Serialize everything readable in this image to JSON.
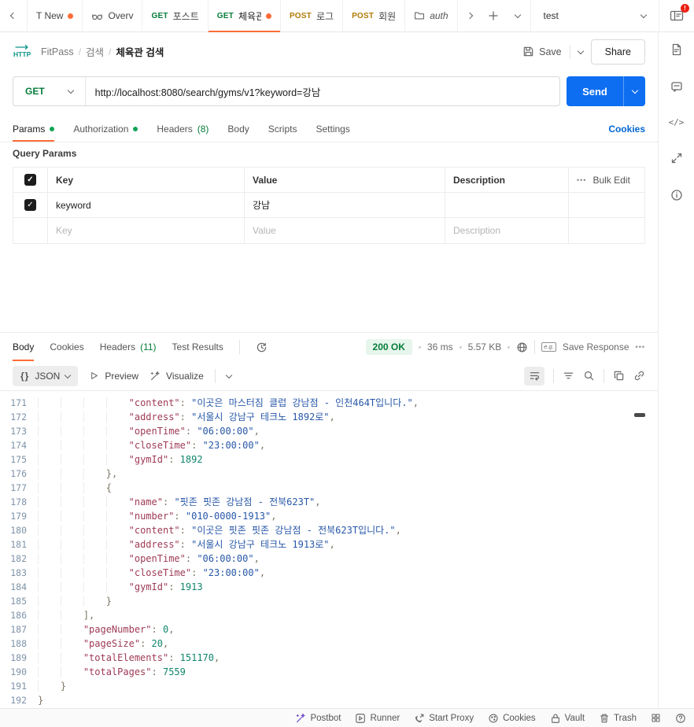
{
  "tab_bar": {
    "tabs": [
      {
        "method": "",
        "label": "T New",
        "modified": true
      },
      {
        "method": "",
        "label": "Overv",
        "icon": "overview-goggles-icon"
      },
      {
        "method": "GET",
        "label": "포스트"
      },
      {
        "method": "GET",
        "label": "체육관",
        "modified": true,
        "active": true
      },
      {
        "method": "POST",
        "label": "로그"
      },
      {
        "method": "POST",
        "label": "회원"
      },
      {
        "method": "",
        "label": "auth",
        "icon": "folder-icon"
      }
    ],
    "workspace": "test",
    "notification_badge": "!"
  },
  "header": {
    "breadcrumb": {
      "collection": "FitPass",
      "folder": "검색",
      "request": "체육관 검색",
      "separator": "/"
    },
    "save_label": "Save",
    "share_label": "Share"
  },
  "request": {
    "method": "GET",
    "url": "http://localhost:8080/search/gyms/v1?keyword=강남",
    "send_label": "Send",
    "tabs": [
      {
        "label": "Params",
        "dot": true,
        "active": true
      },
      {
        "label": "Authorization",
        "dot": true
      },
      {
        "label": "Headers",
        "count": "(8)"
      },
      {
        "label": "Body"
      },
      {
        "label": "Scripts"
      },
      {
        "label": "Settings"
      }
    ],
    "cookies_link": "Cookies",
    "query_params_label": "Query Params",
    "params_table": {
      "headers": {
        "key": "Key",
        "value": "Value",
        "description": "Description",
        "bulk_edit": "Bulk Edit"
      },
      "rows": [
        {
          "checked": true,
          "key": "keyword",
          "value": "강남",
          "description": ""
        }
      ],
      "placeholder": {
        "key": "Key",
        "value": "Value",
        "description": "Description"
      }
    }
  },
  "response": {
    "tabs": [
      {
        "label": "Body",
        "active": true
      },
      {
        "label": "Cookies"
      },
      {
        "label": "Headers",
        "count": "(11)"
      },
      {
        "label": "Test Results"
      }
    ],
    "status": {
      "code_text": "200 OK",
      "time": "36 ms",
      "size": "5.57 KB"
    },
    "save_response_label": "Save Response",
    "toolbar": {
      "braces_glyph": "{}",
      "format": "JSON",
      "preview_label": "Preview",
      "visualize_label": "Visualize"
    },
    "code": {
      "lines": [
        {
          "n": 171,
          "text": "                \"content\": \"이곳은 마스터짐 클럽 강남점 - 인천464T입니다.\","
        },
        {
          "n": 172,
          "text": "                \"address\": \"서울시 강남구 테크노 1892로\","
        },
        {
          "n": 173,
          "text": "                \"openTime\": \"06:00:00\","
        },
        {
          "n": 174,
          "text": "                \"closeTime\": \"23:00:00\","
        },
        {
          "n": 175,
          "text": "                \"gymId\": 1892"
        },
        {
          "n": 176,
          "text": "            },"
        },
        {
          "n": 177,
          "text": "            {"
        },
        {
          "n": 178,
          "text": "                \"name\": \"핏존 핏존 강남점 - 전북623T\","
        },
        {
          "n": 179,
          "text": "                \"number\": \"010-0000-1913\","
        },
        {
          "n": 180,
          "text": "                \"content\": \"이곳은 핏존 핏존 강남점 - 전북623T입니다.\","
        },
        {
          "n": 181,
          "text": "                \"address\": \"서울시 강남구 테크노 1913로\","
        },
        {
          "n": 182,
          "text": "                \"openTime\": \"06:00:00\","
        },
        {
          "n": 183,
          "text": "                \"closeTime\": \"23:00:00\","
        },
        {
          "n": 184,
          "text": "                \"gymId\": 1913"
        },
        {
          "n": 185,
          "text": "            }"
        },
        {
          "n": 186,
          "text": "        ],"
        },
        {
          "n": 187,
          "text": "        \"pageNumber\": 0,"
        },
        {
          "n": 188,
          "text": "        \"pageSize\": 20,"
        },
        {
          "n": 189,
          "text": "        \"totalElements\": 151170,"
        },
        {
          "n": 190,
          "text": "        \"totalPages\": 7559"
        },
        {
          "n": 191,
          "text": "    }"
        },
        {
          "n": 192,
          "text": "}"
        }
      ]
    }
  },
  "status_bar": {
    "items": [
      {
        "icon": "postbot-wand-icon",
        "label": "Postbot"
      },
      {
        "icon": "runner-icon",
        "label": "Runner"
      },
      {
        "icon": "start-proxy-icon",
        "label": "Start Proxy"
      },
      {
        "icon": "cookies-icon",
        "label": "Cookies"
      },
      {
        "icon": "vault-lock-icon",
        "label": "Vault"
      },
      {
        "icon": "trash-icon",
        "label": "Trash"
      }
    ]
  },
  "right_rail": {
    "icons": [
      "documentation-icon",
      "comments-icon",
      "code-snippet-icon",
      "sync-arrows-icon",
      "info-icon"
    ]
  },
  "misc": {
    "check": "✓",
    "more": "•••",
    "bulk_dots": "•••"
  },
  "colors": {
    "accent_orange": "#ff6c37",
    "method_get_green": "#067d3a",
    "method_post_gold": "#b17a05",
    "send_blue": "#0d6ef2",
    "link_blue": "#0265d2",
    "status_green": "#067d3a",
    "status_pill_bg": "#e7f6ec",
    "json_key": "#9e3a55",
    "json_string": "#2858a8",
    "json_number": "#10856c",
    "line_number": "#7f93a8",
    "badge_red": "#eb2013",
    "postbot_purple": "#6e49cb"
  }
}
